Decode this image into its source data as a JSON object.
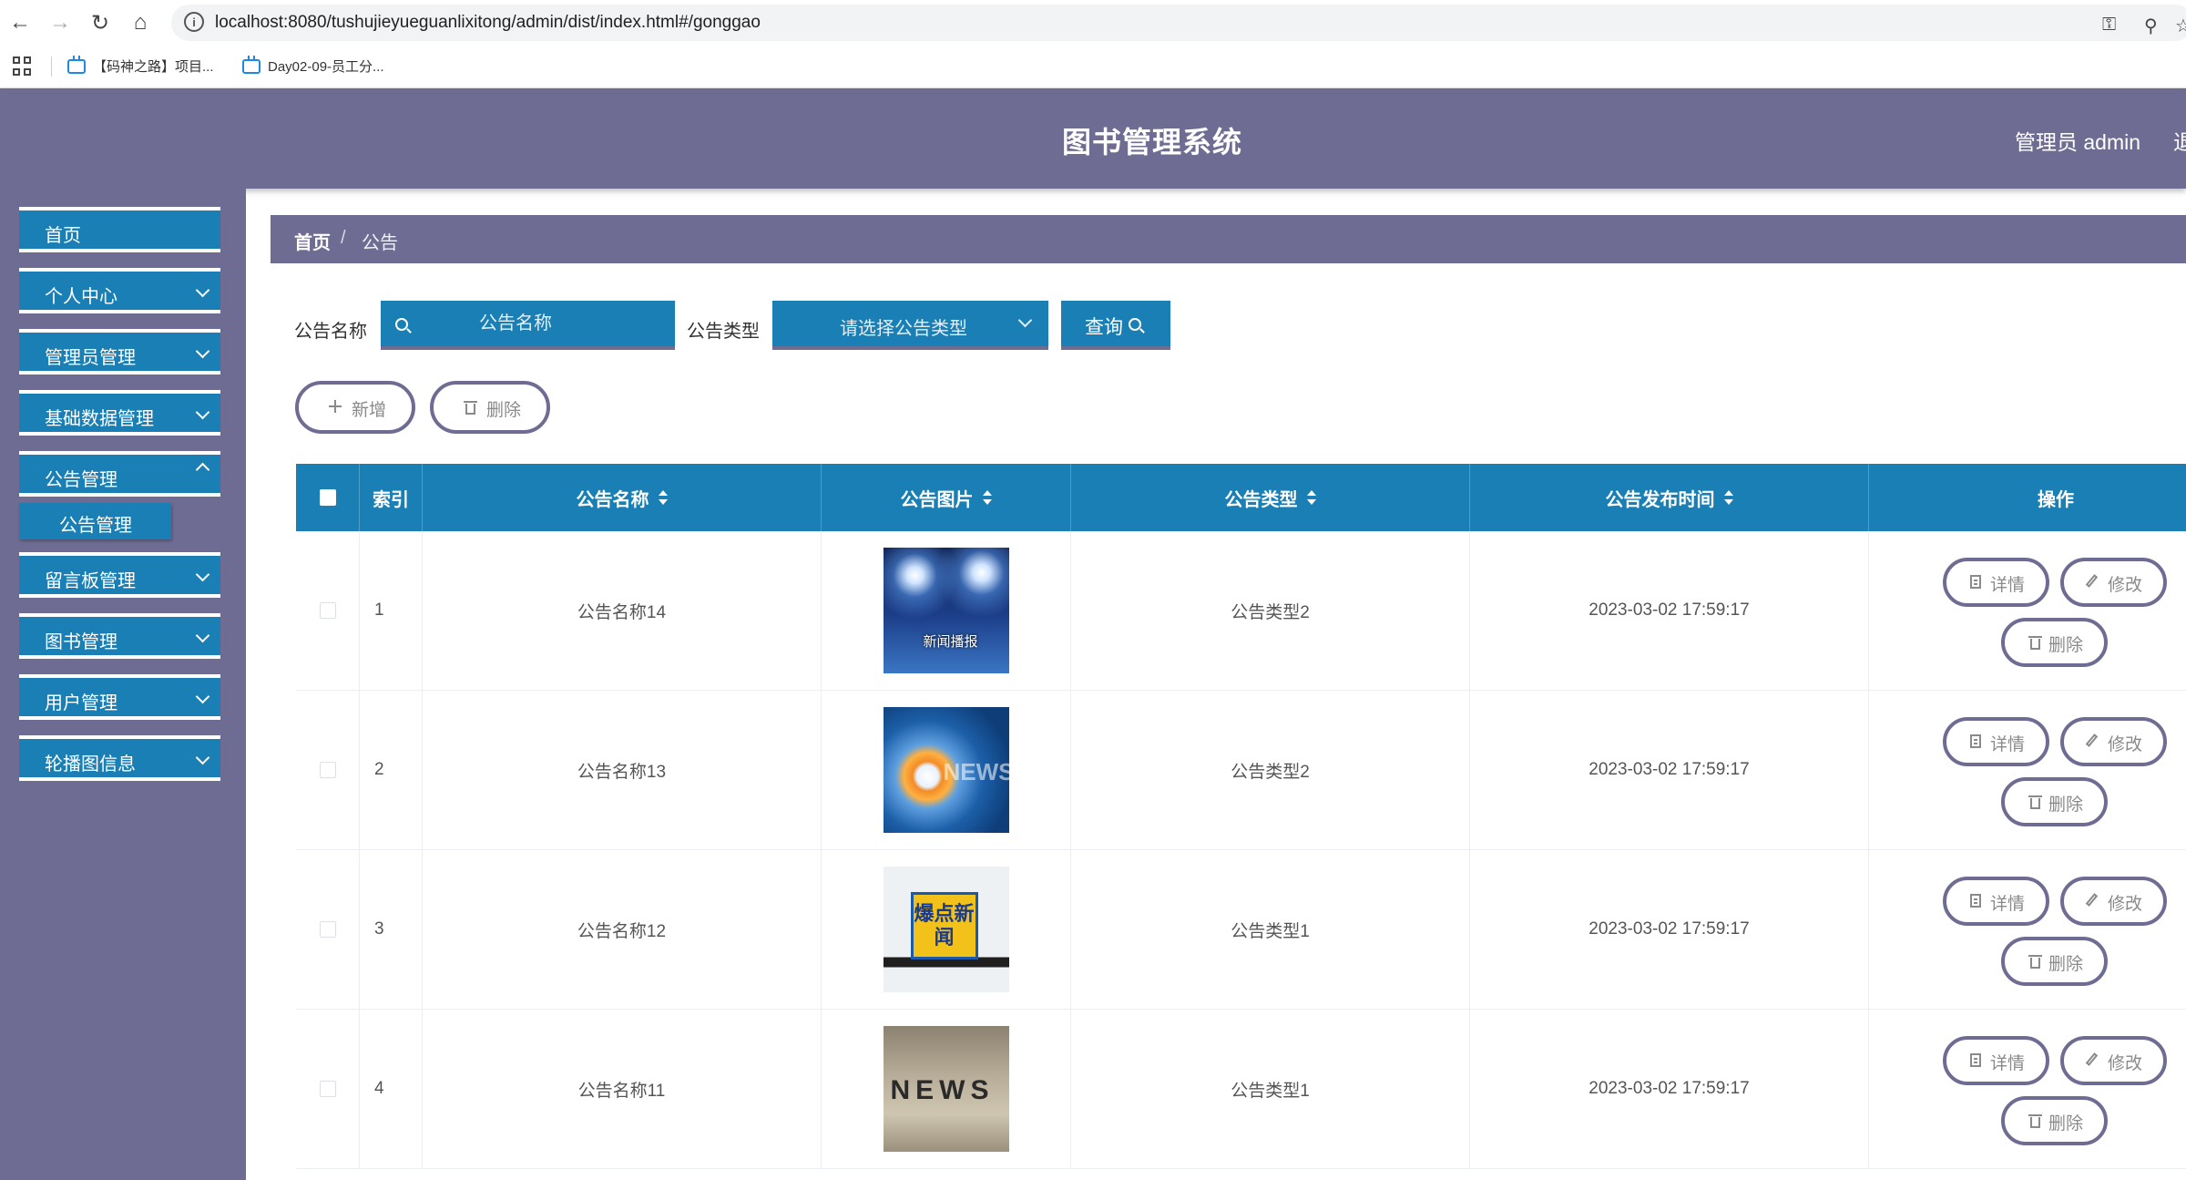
{
  "browser": {
    "url": "localhost:8080/tushujieyueguanlixitong/admin/dist/index.html#/gonggao",
    "bookmarks": [
      "【码神之路】项目...",
      "Day02-09-员工分..."
    ]
  },
  "header": {
    "title": "图书管理系统",
    "user": "管理员 admin",
    "logout": "退"
  },
  "sidebar": {
    "items": [
      {
        "label": "首页"
      },
      {
        "label": "个人中心"
      },
      {
        "label": "管理员管理"
      },
      {
        "label": "基础数据管理"
      },
      {
        "label": "公告管理"
      },
      {
        "label": "留言板管理"
      },
      {
        "label": "图书管理"
      },
      {
        "label": "用户管理"
      },
      {
        "label": "轮播图信息"
      }
    ],
    "sub_item": "公告管理"
  },
  "breadcrumb": {
    "home": "首页",
    "sep": "/",
    "current": "公告"
  },
  "filters": {
    "name_label": "公告名称",
    "name_placeholder": "公告名称",
    "type_label": "公告类型",
    "type_placeholder": "请选择公告类型",
    "query_label": "查询"
  },
  "actions": {
    "add_label": "新增",
    "delete_label": "删除"
  },
  "table": {
    "headers": [
      "索引",
      "公告名称",
      "公告图片",
      "公告类型",
      "公告发布时间",
      "操作"
    ],
    "row_buttons": {
      "detail": "详情",
      "edit": "修改",
      "delete": "删除"
    },
    "rows": [
      {
        "index": "1",
        "name": "公告名称14",
        "image_caption": "新闻播报",
        "type": "公告类型2",
        "time": "2023-03-02 17:59:17"
      },
      {
        "index": "2",
        "name": "公告名称13",
        "image_caption": "NEWS",
        "type": "公告类型2",
        "time": "2023-03-02 17:59:17"
      },
      {
        "index": "3",
        "name": "公告名称12",
        "image_caption": "爆点新闻",
        "type": "公告类型1",
        "time": "2023-03-02 17:59:17"
      },
      {
        "index": "4",
        "name": "公告名称11",
        "image_caption": "NEWS",
        "type": "公告类型1",
        "time": "2023-03-02 17:59:17"
      }
    ]
  },
  "colors": {
    "header": "#6e6c93",
    "accent": "#1a7fb4"
  }
}
